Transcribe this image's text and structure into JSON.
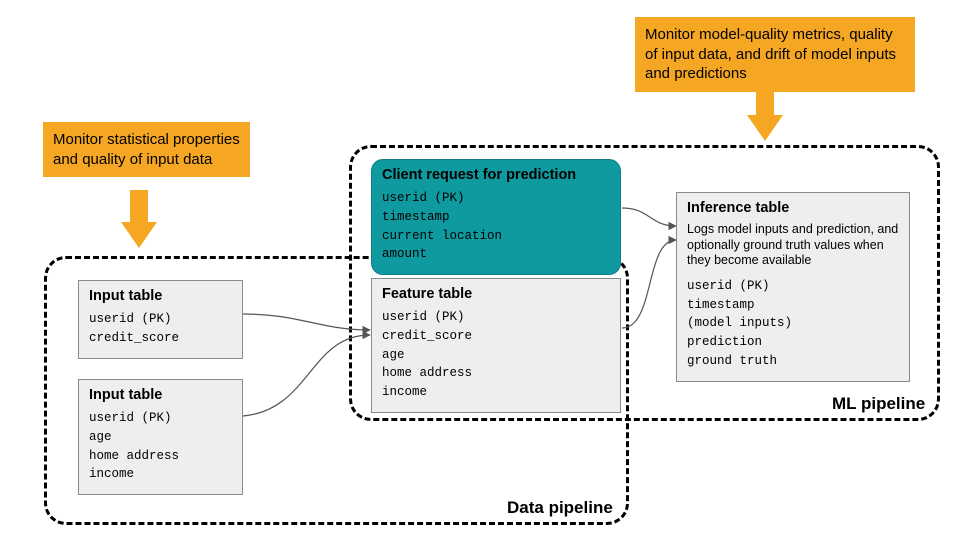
{
  "callouts": {
    "left": "Monitor statistical properties and quality of input data",
    "right": "Monitor model-quality metrics, quality of input data, and drift of model inputs and predictions"
  },
  "regions": {
    "data_pipeline": "Data pipeline",
    "ml_pipeline": "ML pipeline"
  },
  "tables": {
    "input1": {
      "title": "Input table",
      "fields": "userid (PK)\ncredit_score"
    },
    "input2": {
      "title": "Input table",
      "fields": "userid (PK)\nage\nhome address\nincome"
    },
    "client_request": {
      "title": "Client request for prediction",
      "fields": "userid (PK)\ntimestamp\ncurrent location\namount"
    },
    "feature": {
      "title": "Feature table",
      "fields": "userid (PK)\ncredit_score\nage\nhome address\nincome"
    },
    "inference": {
      "title": "Inference table",
      "desc": "Logs model inputs and prediction, and optionally ground truth values when they become available",
      "fields": "userid (PK)\ntimestamp\n(model inputs)\nprediction\nground truth"
    }
  },
  "colors": {
    "callout": "#f5a623",
    "teal": "#0f9aa0",
    "table_bg": "#eeeeee"
  }
}
